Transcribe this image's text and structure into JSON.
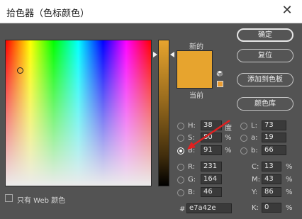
{
  "window": {
    "title": "拾色器（色标颜色）"
  },
  "swatch": {
    "new_label": "新的",
    "current_label": "当前",
    "new_color": "#e7a42e",
    "current_color": "#e7a42e"
  },
  "buttons": {
    "ok": "确定",
    "reset": "复位",
    "add_to_swatches": "添加到色板",
    "color_libraries": "颜色库"
  },
  "hsb": {
    "h": {
      "label": "H:",
      "value": "38",
      "unit": "度"
    },
    "s": {
      "label": "S:",
      "value": "80",
      "unit": "%"
    },
    "b": {
      "label": "B:",
      "value": "91",
      "unit": "%"
    }
  },
  "rgb": {
    "r": {
      "label": "R:",
      "value": "231"
    },
    "g": {
      "label": "G:",
      "value": "164"
    },
    "b": {
      "label": "B:",
      "value": "46"
    }
  },
  "lab": {
    "l": {
      "label": "L:",
      "value": "73"
    },
    "a": {
      "label": "a:",
      "value": "19"
    },
    "b": {
      "label": "b:",
      "value": "66"
    }
  },
  "cmyk": {
    "c": {
      "label": "C:",
      "value": "13",
      "unit": "%"
    },
    "m": {
      "label": "M:",
      "value": "43",
      "unit": "%"
    },
    "y": {
      "label": "Y:",
      "value": "86",
      "unit": "%"
    },
    "k": {
      "label": "K:",
      "value": "0",
      "unit": "%"
    }
  },
  "hex": {
    "label": "#",
    "value": "e7a42e"
  },
  "web_only": {
    "label": "只有 Web 颜色",
    "checked": false
  },
  "selected_mode": "B",
  "colors": {
    "background": "#535353",
    "accent_arrow": "#e02020"
  }
}
